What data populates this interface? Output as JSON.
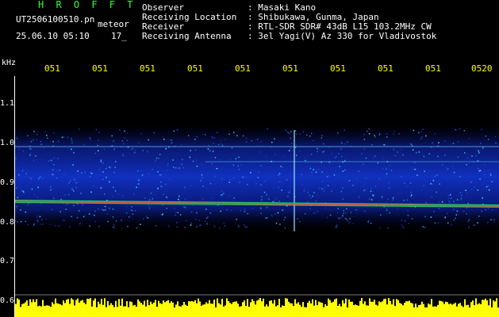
{
  "header": {
    "brand": "H R O F F T",
    "filename": "UT2506100510.pn",
    "kind": "meteor",
    "datetime": "25.06.10 05:10",
    "index": "17_"
  },
  "info": [
    {
      "label": "Observer",
      "value": ": Masaki Kano"
    },
    {
      "label": "Receiving Location",
      "value": ": Shibukawa, Gunma, Japan"
    },
    {
      "label": "Receiver",
      "value": ": RTL-SDR SDR# 43dB L15 103.2MHz CW"
    },
    {
      "label": "Receiving Antenna",
      "value": ": 3el Yagi(V) Az 330 for Vladivostok"
    }
  ],
  "axis": {
    "y_unit": "kHz",
    "y_ticks": [
      "1.1",
      "1.0",
      "0.9",
      "0.8",
      "0.7",
      "0.6"
    ],
    "x_ticks": [
      "051",
      "051",
      "051",
      "051",
      "051",
      "051",
      "051",
      "051",
      "051",
      "0520"
    ]
  },
  "colors": {
    "brand": "#33ff33",
    "tick": "#ffff00",
    "background": "#000000",
    "noise_bar": "#ffff00"
  }
}
